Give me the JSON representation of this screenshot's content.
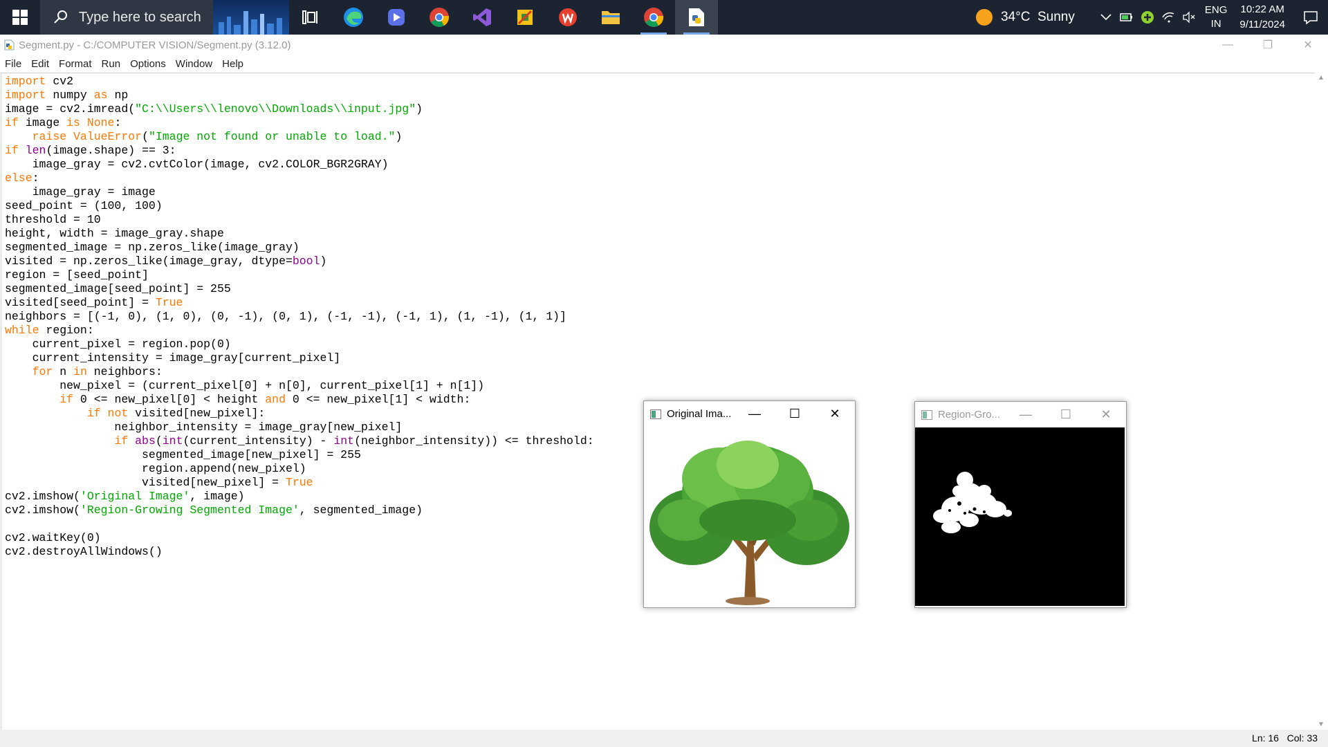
{
  "taskbar": {
    "search_placeholder": "Type here to search",
    "apps": [
      "task-view",
      "edge",
      "copilot",
      "chrome",
      "visual-studio",
      "paint",
      "wps-office",
      "file-explorer",
      "chrome-profile",
      "python-idle"
    ],
    "weather": {
      "temp": "34°C",
      "condition": "Sunny"
    },
    "language": {
      "line1": "ENG",
      "line2": "IN"
    },
    "clock": {
      "time": "10:22 AM",
      "date": "9/11/2024"
    }
  },
  "window": {
    "title": "Segment.py - C:/COMPUTER VISION/Segment.py (3.12.0)",
    "menu": [
      "File",
      "Edit",
      "Format",
      "Run",
      "Options",
      "Window",
      "Help"
    ],
    "status": {
      "line": "Ln: 16",
      "col": "Col: 33"
    }
  },
  "code": [
    [
      [
        "kw",
        "import"
      ],
      [
        "t",
        " cv2"
      ]
    ],
    [
      [
        "kw",
        "import"
      ],
      [
        "t",
        " numpy "
      ],
      [
        "kw",
        "as"
      ],
      [
        "t",
        " np"
      ]
    ],
    [
      [
        "t",
        "image = cv2.imread("
      ],
      [
        "str",
        "\"C:\\\\Users\\\\lenovo\\\\Downloads\\\\input.jpg\""
      ],
      [
        "t",
        ")"
      ]
    ],
    [
      [
        "kw",
        "if"
      ],
      [
        "t",
        " image "
      ],
      [
        "kw",
        "is"
      ],
      [
        "t",
        " "
      ],
      [
        "kw",
        "None"
      ],
      [
        "t",
        ":"
      ]
    ],
    [
      [
        "t",
        "    "
      ],
      [
        "kw",
        "raise"
      ],
      [
        "t",
        " "
      ],
      [
        "kw",
        "ValueError"
      ],
      [
        "t",
        "("
      ],
      [
        "str",
        "\"Image not found or unable to load.\""
      ],
      [
        "t",
        ")"
      ]
    ],
    [
      [
        "kw",
        "if"
      ],
      [
        "t",
        " "
      ],
      [
        "bi",
        "len"
      ],
      [
        "t",
        "(image.shape) == 3:"
      ]
    ],
    [
      [
        "t",
        "    image_gray = cv2.cvtColor(image, cv2.COLOR_BGR2GRAY)"
      ]
    ],
    [
      [
        "kw",
        "else"
      ],
      [
        "t",
        ":"
      ]
    ],
    [
      [
        "t",
        "    image_gray = image"
      ]
    ],
    [
      [
        "t",
        "seed_point = (100, 100)"
      ]
    ],
    [
      [
        "t",
        "threshold = 10"
      ]
    ],
    [
      [
        "t",
        "height, width = image_gray.shape"
      ]
    ],
    [
      [
        "t",
        "segmented_image = np.zeros_like(image_gray)"
      ]
    ],
    [
      [
        "t",
        "visited = np.zeros_like(image_gray, dtype="
      ],
      [
        "bi",
        "bool"
      ],
      [
        "t",
        ")"
      ]
    ],
    [
      [
        "t",
        "region = [seed_point]"
      ]
    ],
    [
      [
        "t",
        "segmented_image[seed_point] = 255"
      ]
    ],
    [
      [
        "t",
        "visited[seed_point] = "
      ],
      [
        "kw",
        "True"
      ]
    ],
    [
      [
        "t",
        "neighbors = [(-1, 0), (1, 0), (0, -1), (0, 1), (-1, -1), (-1, 1), (1, -1), (1, 1)]"
      ]
    ],
    [
      [
        "kw",
        "while"
      ],
      [
        "t",
        " region:"
      ]
    ],
    [
      [
        "t",
        "    current_pixel = region.pop(0)"
      ]
    ],
    [
      [
        "t",
        "    current_intensity = image_gray[current_pixel]"
      ]
    ],
    [
      [
        "t",
        "    "
      ],
      [
        "kw",
        "for"
      ],
      [
        "t",
        " n "
      ],
      [
        "kw",
        "in"
      ],
      [
        "t",
        " neighbors:"
      ]
    ],
    [
      [
        "t",
        "        new_pixel = (current_pixel[0] + n[0], current_pixel[1] + n[1])"
      ]
    ],
    [
      [
        "t",
        "        "
      ],
      [
        "kw",
        "if"
      ],
      [
        "t",
        " 0 <= new_pixel[0] < height "
      ],
      [
        "kw",
        "and"
      ],
      [
        "t",
        " 0 <= new_pixel[1] < width:"
      ]
    ],
    [
      [
        "t",
        "            "
      ],
      [
        "kw",
        "if"
      ],
      [
        "t",
        " "
      ],
      [
        "kw",
        "not"
      ],
      [
        "t",
        " visited[new_pixel]:"
      ]
    ],
    [
      [
        "t",
        "                neighbor_intensity = image_gray[new_pixel]"
      ]
    ],
    [
      [
        "t",
        "                "
      ],
      [
        "kw",
        "if"
      ],
      [
        "t",
        " "
      ],
      [
        "bi",
        "abs"
      ],
      [
        "t",
        "("
      ],
      [
        "bi",
        "int"
      ],
      [
        "t",
        "(current_intensity) - "
      ],
      [
        "bi",
        "int"
      ],
      [
        "t",
        "(neighbor_intensity)) <= threshold:"
      ]
    ],
    [
      [
        "t",
        "                    segmented_image[new_pixel] = 255"
      ]
    ],
    [
      [
        "t",
        "                    region.append(new_pixel)"
      ]
    ],
    [
      [
        "t",
        "                    visited[new_pixel] = "
      ],
      [
        "kw",
        "True"
      ]
    ],
    [
      [
        "t",
        "cv2.imshow("
      ],
      [
        "str",
        "'Original Image'"
      ],
      [
        "t",
        ", image)"
      ]
    ],
    [
      [
        "t",
        "cv2.imshow("
      ],
      [
        "str",
        "'Region-Growing Segmented Image'"
      ],
      [
        "t",
        ", segmented_image)"
      ]
    ],
    [
      [
        "t",
        ""
      ]
    ],
    [
      [
        "t",
        "cv2.waitKey(0)"
      ]
    ],
    [
      [
        "t",
        "cv2.destroyAllWindows()"
      ]
    ]
  ],
  "cv_windows": {
    "original": {
      "title": "Original Ima..."
    },
    "segmented": {
      "title": "Region-Gro..."
    }
  }
}
